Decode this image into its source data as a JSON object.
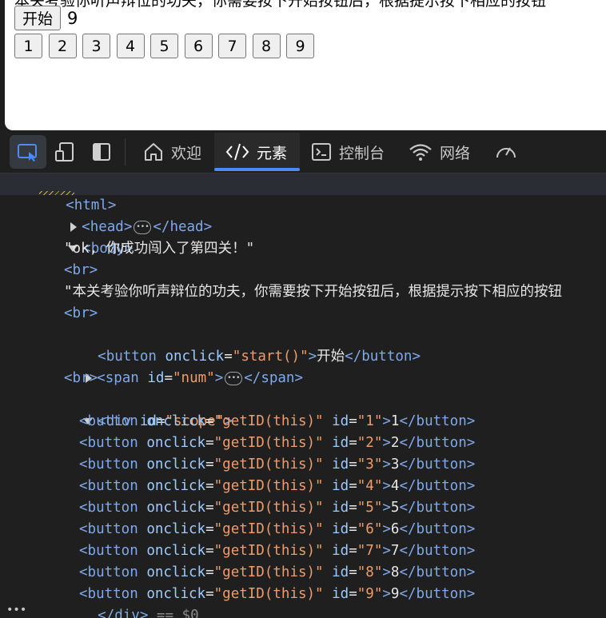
{
  "page": {
    "cut_off_text": "本关考验你听声辩位的功夫，你需要按下开始按钮后，根据提示按下相应的按钮",
    "start_button": "开始",
    "num_value": "9",
    "number_buttons": [
      "1",
      "2",
      "3",
      "4",
      "5",
      "6",
      "7",
      "8",
      "9"
    ]
  },
  "devtools": {
    "tabs": [
      {
        "label": "欢迎",
        "icon": "home-icon"
      },
      {
        "label": "元素",
        "icon": "code-icon",
        "active": true
      },
      {
        "label": "控制台",
        "icon": "console-icon"
      },
      {
        "label": "网络",
        "icon": "wifi-icon"
      },
      {
        "label": "",
        "icon": "performance-icon"
      }
    ],
    "tree": {
      "html_tag": "<html>",
      "head_open": "<head>",
      "head_close": "</head>",
      "body_open": "<body>",
      "text1": "\"ok, 你成功闯入了第四关！\"",
      "br": "<br>",
      "text2": "\"本关考验你听声辩位的功夫，你需要按下开始按钮后，根据提示按下相应的按钮",
      "button_line": {
        "open": "<button",
        "attr": "onclick",
        "eq": "=",
        "value": "\"start()\"",
        "close": ">",
        "text": "开始",
        "end": "</button>"
      },
      "span_line": {
        "open": "<span",
        "attr": "id",
        "value": "\"num\"",
        "end": "</span>"
      },
      "div_line": {
        "open": "<div",
        "attr": "id",
        "value": "\"scope\""
      },
      "buttons": [
        {
          "id": "\"1\"",
          "text": "1"
        },
        {
          "id": "\"2\"",
          "text": "2"
        },
        {
          "id": "\"3\"",
          "text": "3"
        },
        {
          "id": "\"4\"",
          "text": "4"
        },
        {
          "id": "\"5\"",
          "text": "5"
        },
        {
          "id": "\"6\"",
          "text": "6"
        },
        {
          "id": "\"7\"",
          "text": "7"
        },
        {
          "id": "\"8\"",
          "text": "8"
        },
        {
          "id": "\"9\"",
          "text": "9"
        }
      ],
      "button_onclick_value": "\"getID(this)\"",
      "div_close": "</div>",
      "div_close_suffix": "== $0"
    }
  },
  "colors": {
    "accent": "#4c8bf5",
    "tag": "#7fa9e8",
    "attr_value": "#ee9c6b"
  }
}
